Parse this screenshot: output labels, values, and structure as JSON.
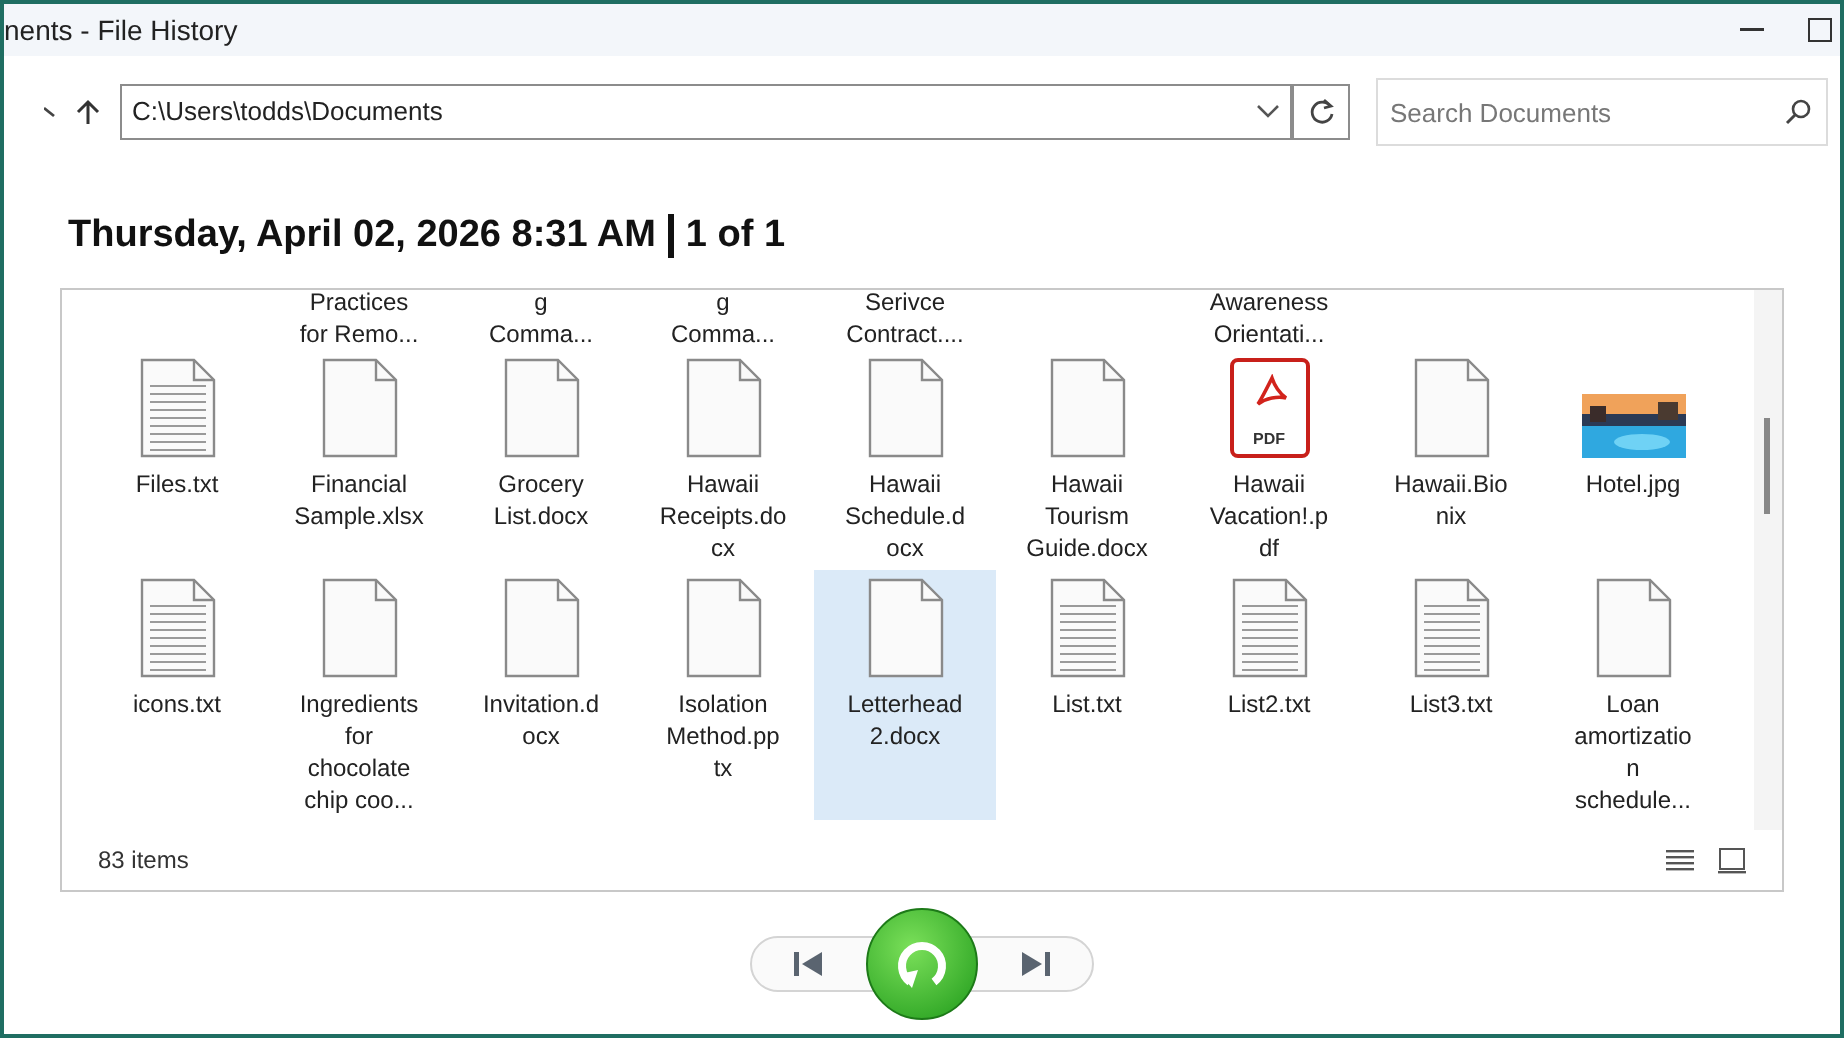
{
  "window": {
    "title": "nents - File History"
  },
  "address": {
    "path": "C:\\Users\\todds\\Documents"
  },
  "search": {
    "placeholder": "Search Documents"
  },
  "heading": {
    "date": "Thursday, April 02, 2026 8:31 AM",
    "page": "1 of 1"
  },
  "partial_row": [
    {
      "kind": "blank"
    },
    {
      "kind": "label",
      "lines": [
        "Practices",
        "for Remo..."
      ]
    },
    {
      "kind": "label",
      "lines": [
        "g",
        "Comma..."
      ]
    },
    {
      "kind": "label",
      "lines": [
        "g",
        "Comma..."
      ]
    },
    {
      "kind": "label",
      "lines": [
        "Serivce",
        "Contract...."
      ]
    },
    {
      "kind": "blank"
    },
    {
      "kind": "label",
      "lines": [
        "Awareness",
        "Orientati..."
      ]
    },
    {
      "kind": "blank"
    },
    {
      "kind": "blank"
    }
  ],
  "files": [
    {
      "kind": "text",
      "lines": [
        "Files.txt"
      ],
      "selected": false
    },
    {
      "kind": "doc",
      "lines": [
        "Financial",
        "Sample.xlsx"
      ],
      "selected": false
    },
    {
      "kind": "doc",
      "lines": [
        "Grocery",
        "List.docx"
      ],
      "selected": false
    },
    {
      "kind": "doc",
      "lines": [
        "Hawaii",
        "Receipts.do",
        "cx"
      ],
      "selected": false
    },
    {
      "kind": "doc",
      "lines": [
        "Hawaii",
        "Schedule.d",
        "ocx"
      ],
      "selected": false
    },
    {
      "kind": "doc",
      "lines": [
        "Hawaii",
        "Tourism",
        "Guide.docx"
      ],
      "selected": false
    },
    {
      "kind": "pdf",
      "lines": [
        "Hawaii",
        "Vacation!.p",
        "df"
      ],
      "selected": false,
      "badge": "PDF"
    },
    {
      "kind": "doc",
      "lines": [
        "Hawaii.Bio",
        "nix"
      ],
      "selected": false
    },
    {
      "lines": [
        "Hotel.jpg"
      ],
      "selected": false
    },
    {
      "kind": "text",
      "lines": [
        "icons.txt"
      ],
      "selected": false
    },
    {
      "kind": "doc",
      "lines": [
        "Ingredients",
        "for",
        "chocolate",
        "chip coo..."
      ],
      "selected": false
    },
    {
      "kind": "doc",
      "lines": [
        "Invitation.d",
        "ocx"
      ],
      "selected": false
    },
    {
      "kind": "doc",
      "lines": [
        "Isolation",
        "Method.pp",
        "tx"
      ],
      "selected": false
    },
    {
      "kind": "doc",
      "lines": [
        "Letterhead",
        "2.docx"
      ],
      "selected": true
    },
    {
      "kind": "text",
      "lines": [
        "List.txt"
      ],
      "selected": false
    },
    {
      "kind": "text",
      "lines": [
        "List2.txt"
      ],
      "selected": false
    },
    {
      "kind": "text",
      "lines": [
        "List3.txt"
      ],
      "selected": false
    },
    {
      "kind": "doc",
      "lines": [
        "Loan",
        "amortizatio",
        "n",
        "schedule..."
      ],
      "selected": false
    }
  ],
  "status_bar": {
    "count": "83 items"
  }
}
